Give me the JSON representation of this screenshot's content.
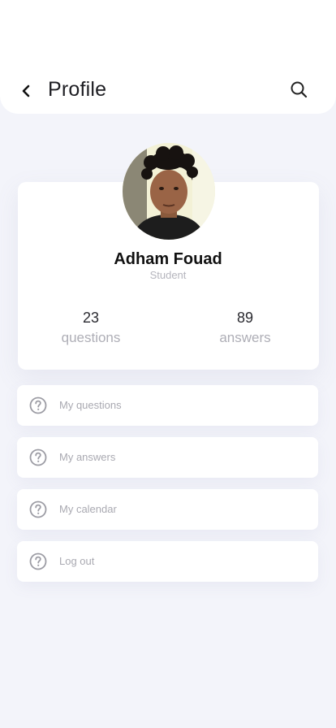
{
  "header": {
    "title": "Profile",
    "back_icon": "chevron-left-icon",
    "search_icon": "search-icon"
  },
  "profile": {
    "name": "Adham Fouad",
    "role": "Student",
    "avatar": "user-photo"
  },
  "stats": [
    {
      "value": "23",
      "label": "questions"
    },
    {
      "value": "89",
      "label": "answers"
    }
  ],
  "menu": [
    {
      "label": "My questions",
      "icon": "question-circle-icon"
    },
    {
      "label": "My answers",
      "icon": "question-circle-icon"
    },
    {
      "label": "My calendar",
      "icon": "question-circle-icon"
    },
    {
      "label": "Log out",
      "icon": "question-circle-icon"
    }
  ],
  "colors": {
    "background": "#f3f4fa",
    "card": "#ffffff",
    "text_primary": "#111111",
    "text_muted": "#aeaeb6"
  }
}
